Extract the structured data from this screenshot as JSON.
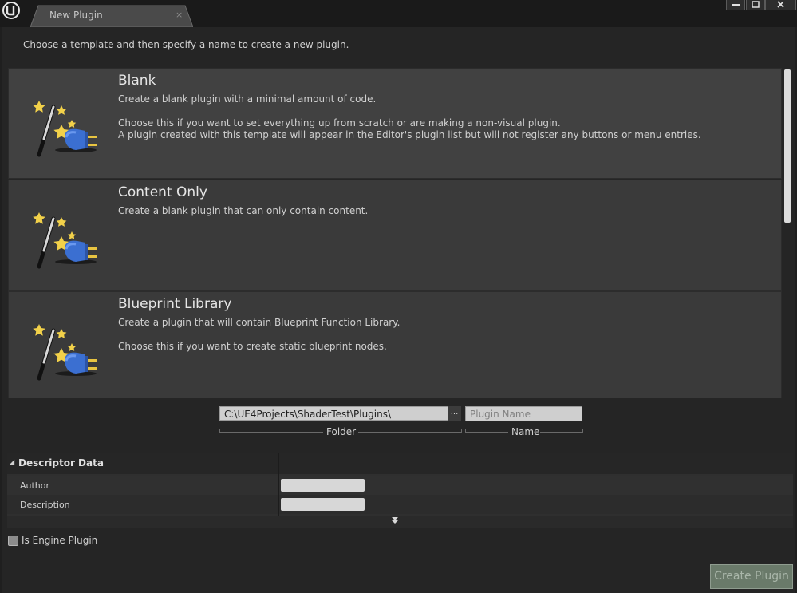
{
  "window": {
    "tab_title": "New Plugin",
    "tab_close": "×",
    "controls": [
      "minimize",
      "maximize",
      "close"
    ]
  },
  "instructions": "Choose a template and then specify a name to create a new plugin.",
  "templates": [
    {
      "title": "Blank",
      "lines": [
        "Create a blank plugin with a minimal amount of code.",
        "",
        "Choose this if you want to set everything up from scratch or are making a non-visual plugin.",
        "A plugin created with this template will appear in the Editor's plugin list but will not register any buttons or menu entries."
      ],
      "icon": "plugin-wand-icon",
      "selected": true
    },
    {
      "title": "Content Only",
      "lines": [
        "Create a blank plugin that can only contain content."
      ],
      "icon": "plugin-wand-icon",
      "selected": false
    },
    {
      "title": "Blueprint Library",
      "lines": [
        "Create a plugin that will contain Blueprint Function Library.",
        "",
        "Choose this if you want to create static blueprint nodes."
      ],
      "icon": "plugin-wand-icon",
      "selected": false
    }
  ],
  "folder": {
    "value": "C:\\UE4Projects\\ShaderTest\\Plugins\\",
    "browse_label": "...",
    "caption": "Folder"
  },
  "name": {
    "placeholder": "Plugin Name",
    "caption": "Name"
  },
  "descriptor": {
    "title": "Descriptor Data",
    "rows": [
      {
        "label": "Author",
        "value": ""
      },
      {
        "label": "Description",
        "value": ""
      }
    ]
  },
  "engine_plugin": {
    "label": "Is Engine Plugin",
    "checked": false
  },
  "create_button": "Create Plugin",
  "colors": {
    "background": "#252525",
    "card": "#3a3a3a",
    "create_button": "#6a7a6a"
  }
}
